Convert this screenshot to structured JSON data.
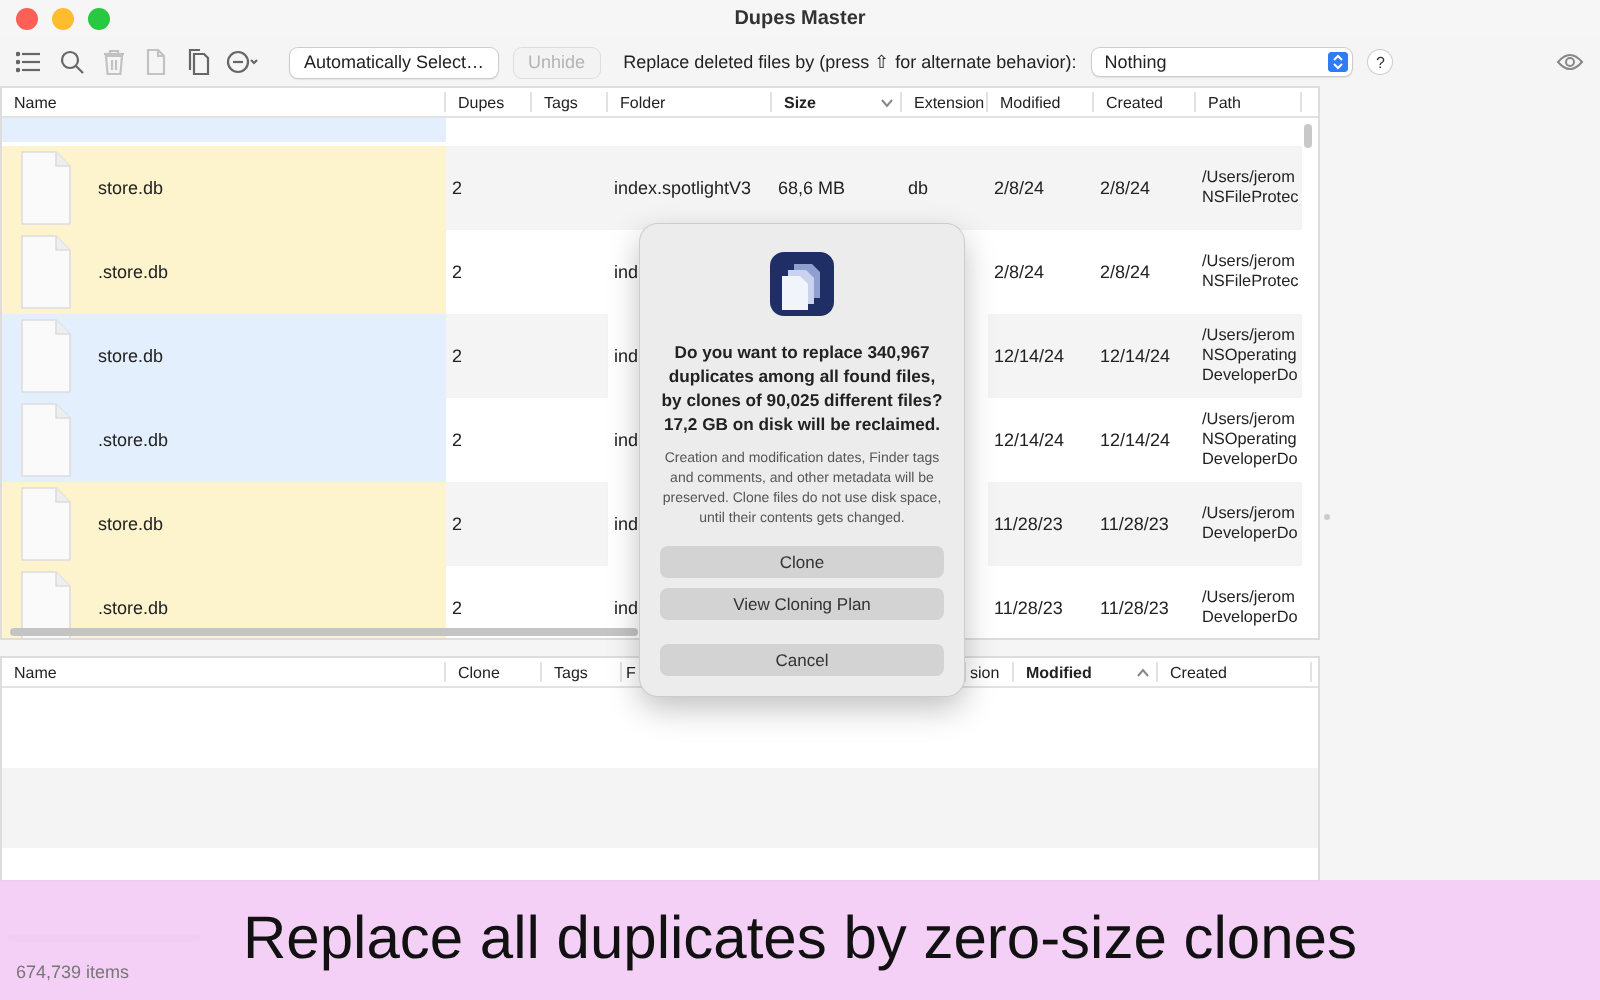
{
  "window": {
    "title": "Dupes Master"
  },
  "toolbar": {
    "tools": [
      {
        "kind": "list",
        "disabled": false
      },
      {
        "kind": "search",
        "disabled": false
      },
      {
        "kind": "trash",
        "disabled": true
      },
      {
        "kind": "document",
        "disabled": true
      },
      {
        "kind": "copy",
        "disabled": false
      },
      {
        "kind": "minus-menu",
        "disabled": false
      }
    ],
    "buttons": [
      {
        "label": "Automatically Select…",
        "disabled": false
      },
      {
        "label": "Unhide",
        "disabled": true
      }
    ],
    "replace_label": "Replace deleted files by (press ⇧ for alternate behavior):",
    "replace_popup": {
      "value": "Nothing"
    },
    "help_button": "?"
  },
  "top_table": {
    "columns": [
      {
        "label": "Name"
      },
      {
        "label": "Dupes"
      },
      {
        "label": "Tags"
      },
      {
        "label": "Folder"
      },
      {
        "label": "Size",
        "sorted": true,
        "ascending": false
      },
      {
        "label": "Extension"
      },
      {
        "label": "Modified"
      },
      {
        "label": "Created"
      },
      {
        "label": "Path"
      }
    ],
    "rows": [
      {
        "kind": "partial",
        "color": "#e3effd"
      },
      {
        "kind": "file",
        "color": "#fdf3cc",
        "name": "store.db",
        "dupes": "2",
        "folder": "index.spotlightV3",
        "size": "68,6 MB",
        "extension": "db",
        "modified": "2/8/24",
        "created": "2/8/24",
        "path": [
          "/Users/jerom",
          "NSFileProtec"
        ]
      },
      {
        "kind": "file",
        "color": "#fdf3cc",
        "name": ".store.db",
        "dupes": "2",
        "folder": "ind",
        "modified": "2/8/24",
        "created": "2/8/24",
        "path": [
          "/Users/jerom",
          "NSFileProtec"
        ]
      },
      {
        "kind": "file",
        "color": "#e3effd",
        "name": "store.db",
        "dupes": "2",
        "folder": "ind",
        "modified": "12/14/24",
        "created": "12/14/24",
        "path": [
          "/Users/jerom",
          "NSOperating",
          "DeveloperDo"
        ]
      },
      {
        "kind": "file",
        "color": "#e3effd",
        "name": ".store.db",
        "dupes": "2",
        "folder": "ind",
        "modified": "12/14/24",
        "created": "12/14/24",
        "path": [
          "/Users/jerom",
          "NSOperating",
          "DeveloperDo"
        ]
      },
      {
        "kind": "file",
        "color": "#fdf3cc",
        "name": "store.db",
        "dupes": "2",
        "folder": "ind",
        "modified": "11/28/23",
        "created": "11/28/23",
        "path": [
          "/Users/jerom",
          "DeveloperDo"
        ]
      },
      {
        "kind": "file",
        "color": "#fdf3cc",
        "name": ".store.db",
        "dupes": "2",
        "folder": "ind",
        "modified": "11/28/23",
        "created": "11/28/23",
        "path": [
          "/Users/jerom",
          "DeveloperDo"
        ]
      }
    ]
  },
  "bottom_table": {
    "columns": [
      {
        "label": "Name"
      },
      {
        "label": "Clone"
      },
      {
        "label": "Tags"
      },
      {
        "label": "F"
      },
      {
        "label": "sion"
      },
      {
        "label": "Modified",
        "sorted": true,
        "ascending": true
      },
      {
        "label": "Created"
      }
    ]
  },
  "dialog": {
    "title": "Do you want to replace 340,967 duplicates among all found files, by clones of 90,025 different files? 17,2 GB on disk will be reclaimed.",
    "message": "Creation and modification dates, Finder tags and comments, and other metadata will be preserved. Clone files do not use disk space, until their contents gets changed.",
    "buttons": [
      "Clone",
      "View Cloning Plan",
      "Cancel"
    ]
  },
  "status_bar": {
    "count": "674,739 items"
  },
  "banner": {
    "text": "Replace all duplicates by zero-size clones"
  }
}
